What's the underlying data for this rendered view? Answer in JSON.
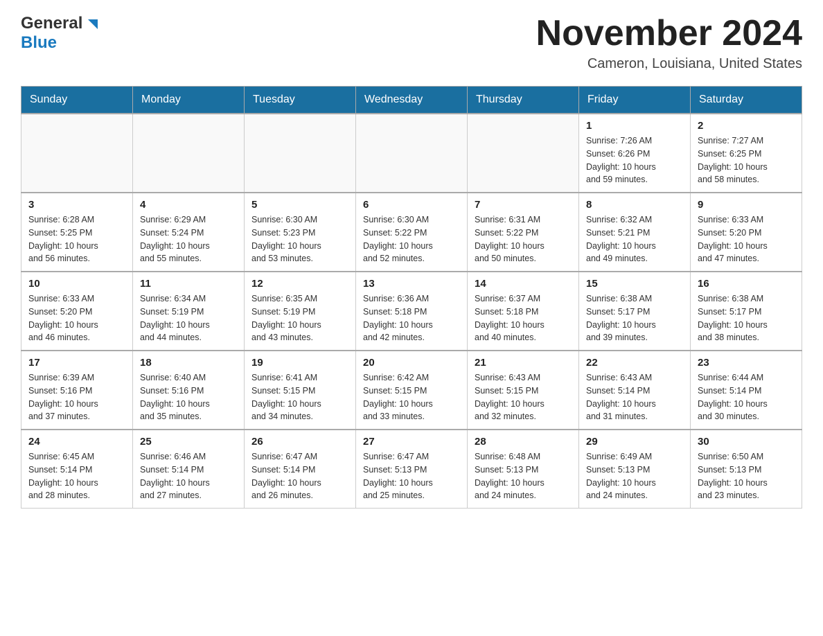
{
  "logo": {
    "general": "General",
    "blue": "Blue"
  },
  "header": {
    "month_year": "November 2024",
    "location": "Cameron, Louisiana, United States"
  },
  "weekdays": [
    "Sunday",
    "Monday",
    "Tuesday",
    "Wednesday",
    "Thursday",
    "Friday",
    "Saturday"
  ],
  "weeks": [
    {
      "days": [
        {
          "num": "",
          "info": ""
        },
        {
          "num": "",
          "info": ""
        },
        {
          "num": "",
          "info": ""
        },
        {
          "num": "",
          "info": ""
        },
        {
          "num": "",
          "info": ""
        },
        {
          "num": "1",
          "info": "Sunrise: 7:26 AM\nSunset: 6:26 PM\nDaylight: 10 hours\nand 59 minutes."
        },
        {
          "num": "2",
          "info": "Sunrise: 7:27 AM\nSunset: 6:25 PM\nDaylight: 10 hours\nand 58 minutes."
        }
      ]
    },
    {
      "days": [
        {
          "num": "3",
          "info": "Sunrise: 6:28 AM\nSunset: 5:25 PM\nDaylight: 10 hours\nand 56 minutes."
        },
        {
          "num": "4",
          "info": "Sunrise: 6:29 AM\nSunset: 5:24 PM\nDaylight: 10 hours\nand 55 minutes."
        },
        {
          "num": "5",
          "info": "Sunrise: 6:30 AM\nSunset: 5:23 PM\nDaylight: 10 hours\nand 53 minutes."
        },
        {
          "num": "6",
          "info": "Sunrise: 6:30 AM\nSunset: 5:22 PM\nDaylight: 10 hours\nand 52 minutes."
        },
        {
          "num": "7",
          "info": "Sunrise: 6:31 AM\nSunset: 5:22 PM\nDaylight: 10 hours\nand 50 minutes."
        },
        {
          "num": "8",
          "info": "Sunrise: 6:32 AM\nSunset: 5:21 PM\nDaylight: 10 hours\nand 49 minutes."
        },
        {
          "num": "9",
          "info": "Sunrise: 6:33 AM\nSunset: 5:20 PM\nDaylight: 10 hours\nand 47 minutes."
        }
      ]
    },
    {
      "days": [
        {
          "num": "10",
          "info": "Sunrise: 6:33 AM\nSunset: 5:20 PM\nDaylight: 10 hours\nand 46 minutes."
        },
        {
          "num": "11",
          "info": "Sunrise: 6:34 AM\nSunset: 5:19 PM\nDaylight: 10 hours\nand 44 minutes."
        },
        {
          "num": "12",
          "info": "Sunrise: 6:35 AM\nSunset: 5:19 PM\nDaylight: 10 hours\nand 43 minutes."
        },
        {
          "num": "13",
          "info": "Sunrise: 6:36 AM\nSunset: 5:18 PM\nDaylight: 10 hours\nand 42 minutes."
        },
        {
          "num": "14",
          "info": "Sunrise: 6:37 AM\nSunset: 5:18 PM\nDaylight: 10 hours\nand 40 minutes."
        },
        {
          "num": "15",
          "info": "Sunrise: 6:38 AM\nSunset: 5:17 PM\nDaylight: 10 hours\nand 39 minutes."
        },
        {
          "num": "16",
          "info": "Sunrise: 6:38 AM\nSunset: 5:17 PM\nDaylight: 10 hours\nand 38 minutes."
        }
      ]
    },
    {
      "days": [
        {
          "num": "17",
          "info": "Sunrise: 6:39 AM\nSunset: 5:16 PM\nDaylight: 10 hours\nand 37 minutes."
        },
        {
          "num": "18",
          "info": "Sunrise: 6:40 AM\nSunset: 5:16 PM\nDaylight: 10 hours\nand 35 minutes."
        },
        {
          "num": "19",
          "info": "Sunrise: 6:41 AM\nSunset: 5:15 PM\nDaylight: 10 hours\nand 34 minutes."
        },
        {
          "num": "20",
          "info": "Sunrise: 6:42 AM\nSunset: 5:15 PM\nDaylight: 10 hours\nand 33 minutes."
        },
        {
          "num": "21",
          "info": "Sunrise: 6:43 AM\nSunset: 5:15 PM\nDaylight: 10 hours\nand 32 minutes."
        },
        {
          "num": "22",
          "info": "Sunrise: 6:43 AM\nSunset: 5:14 PM\nDaylight: 10 hours\nand 31 minutes."
        },
        {
          "num": "23",
          "info": "Sunrise: 6:44 AM\nSunset: 5:14 PM\nDaylight: 10 hours\nand 30 minutes."
        }
      ]
    },
    {
      "days": [
        {
          "num": "24",
          "info": "Sunrise: 6:45 AM\nSunset: 5:14 PM\nDaylight: 10 hours\nand 28 minutes."
        },
        {
          "num": "25",
          "info": "Sunrise: 6:46 AM\nSunset: 5:14 PM\nDaylight: 10 hours\nand 27 minutes."
        },
        {
          "num": "26",
          "info": "Sunrise: 6:47 AM\nSunset: 5:14 PM\nDaylight: 10 hours\nand 26 minutes."
        },
        {
          "num": "27",
          "info": "Sunrise: 6:47 AM\nSunset: 5:13 PM\nDaylight: 10 hours\nand 25 minutes."
        },
        {
          "num": "28",
          "info": "Sunrise: 6:48 AM\nSunset: 5:13 PM\nDaylight: 10 hours\nand 24 minutes."
        },
        {
          "num": "29",
          "info": "Sunrise: 6:49 AM\nSunset: 5:13 PM\nDaylight: 10 hours\nand 24 minutes."
        },
        {
          "num": "30",
          "info": "Sunrise: 6:50 AM\nSunset: 5:13 PM\nDaylight: 10 hours\nand 23 minutes."
        }
      ]
    }
  ]
}
